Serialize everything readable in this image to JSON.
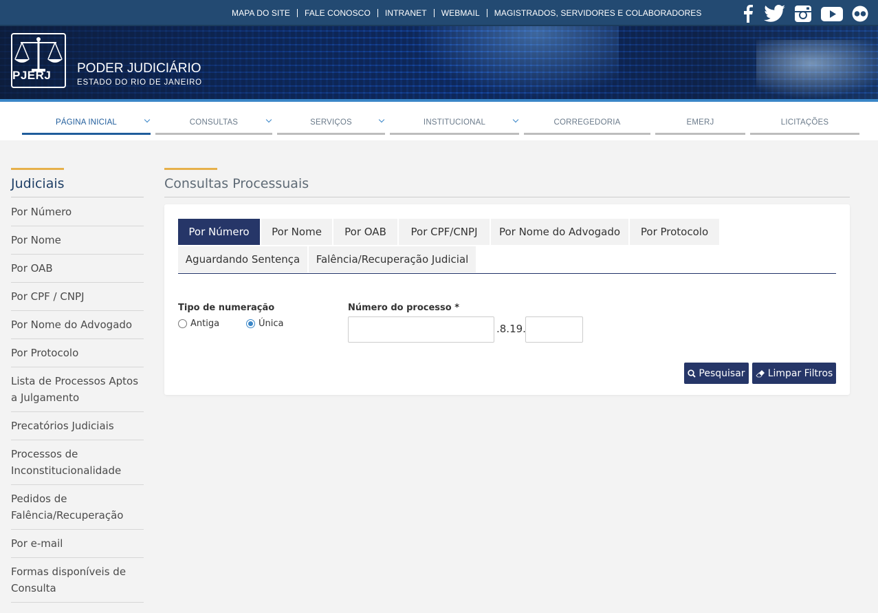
{
  "top_links": [
    "MAPA DO SITE",
    "FALE CONOSCO",
    "INTRANET",
    "WEBMAIL",
    "MAGISTRADOS, SERVIDORES E COLABORADORES"
  ],
  "social_icons": [
    "facebook-icon",
    "twitter-icon",
    "instagram-icon",
    "youtube-icon",
    "flickr-icon"
  ],
  "header": {
    "logo_text": "PJERJ",
    "title": "PODER JUDICIÁRIO",
    "subtitle": "ESTADO DO RIO DE JANEIRO"
  },
  "nav": {
    "items": [
      {
        "label": "PÁGINA INICIAL",
        "dropdown": true,
        "active": true
      },
      {
        "label": "CONSULTAS",
        "dropdown": true
      },
      {
        "label": "SERVIÇOS",
        "dropdown": true
      },
      {
        "label": "INSTITUCIONAL",
        "dropdown": true
      },
      {
        "label": "CORREGEDORIA",
        "dropdown": false
      },
      {
        "label": "EMERJ",
        "dropdown": false
      },
      {
        "label": "LICITAÇÕES",
        "dropdown": false
      }
    ]
  },
  "sidebar": {
    "title": "Judiciais",
    "items": [
      "Por Número",
      "Por Nome",
      "Por OAB",
      "Por CPF / CNPJ",
      "Por Nome do Advogado",
      "Por Protocolo",
      "Lista de Processos Aptos a Julgamento",
      "Precatórios Judiciais",
      "Processos de Inconstitucionalidade",
      "Pedidos de Falência/Recuperação",
      "Por e-mail",
      "Formas disponíveis de Consulta"
    ]
  },
  "main": {
    "title": "Consultas Processuais",
    "tabs": [
      "Por Número",
      "Por Nome",
      "Por OAB",
      "Por CPF/CNPJ",
      "Por Nome do Advogado",
      "Por Protocolo",
      "Aguardando Sentença",
      "Falência/Recuperação Judicial"
    ],
    "active_tab": "Por Número",
    "form": {
      "tipo_label": "Tipo de numeração",
      "radio_antiga": "Antiga",
      "radio_unica": "Única",
      "selected": "Única",
      "numero_label": "Número do processo *",
      "numero_value": "",
      "separator": ".8.19.",
      "suffix_value": ""
    },
    "buttons": {
      "search": "Pesquisar",
      "clear": "Limpar Filtros"
    }
  },
  "colors": {
    "topbar": "#234a72",
    "accent": "#e6b04a",
    "tab_active": "#263668",
    "link_blue": "#3a86c7"
  }
}
